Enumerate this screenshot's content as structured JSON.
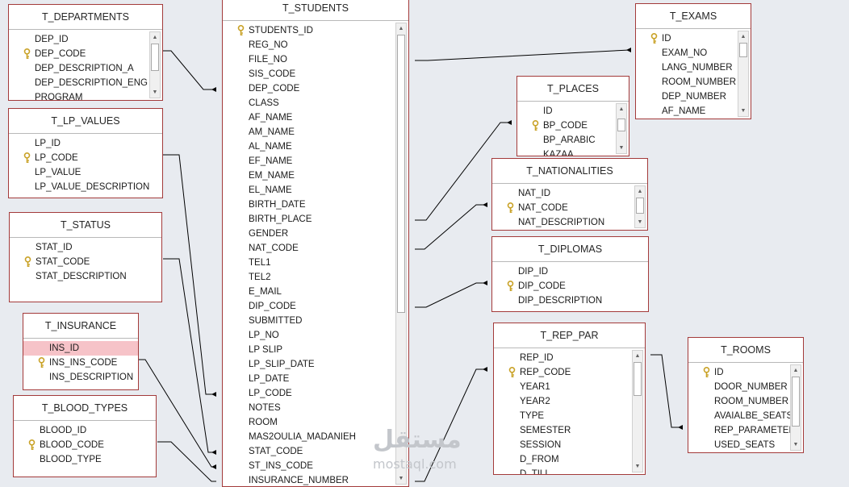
{
  "tables": [
    {
      "id": "t_departments",
      "title": "T_DEPARTMENTS",
      "fields": [
        {
          "name": "DEP_ID"
        },
        {
          "name": "DEP_CODE",
          "key": true
        },
        {
          "name": "DEP_DESCRIPTION_A"
        },
        {
          "name": "DEP_DESCRIPTION_ENG"
        },
        {
          "name": "PROGRAM"
        }
      ]
    },
    {
      "id": "t_lp_values",
      "title": "T_LP_VALUES",
      "fields": [
        {
          "name": "LP_ID"
        },
        {
          "name": "LP_CODE",
          "key": true
        },
        {
          "name": "LP_VALUE"
        },
        {
          "name": "LP_VALUE_DESCRIPTION"
        }
      ]
    },
    {
      "id": "t_status",
      "title": "T_STATUS",
      "fields": [
        {
          "name": "STAT_ID"
        },
        {
          "name": "STAT_CODE",
          "key": true
        },
        {
          "name": "STAT_DESCRIPTION"
        }
      ]
    },
    {
      "id": "t_insurance",
      "title": "T_INSURANCE",
      "fields": [
        {
          "name": "INS_ID",
          "selected": true
        },
        {
          "name": "INS_INS_CODE",
          "key": true
        },
        {
          "name": "INS_DESCRIPTION"
        }
      ]
    },
    {
      "id": "t_blood_types",
      "title": "T_BLOOD_TYPES",
      "fields": [
        {
          "name": "BLOOD_ID"
        },
        {
          "name": "BLOOD_CODE",
          "key": true
        },
        {
          "name": "BLOOD_TYPE"
        }
      ]
    },
    {
      "id": "t_students",
      "title": "T_STUDENTS",
      "fields": [
        {
          "name": "STUDENTS_ID",
          "key": true
        },
        {
          "name": "REG_NO"
        },
        {
          "name": "FILE_NO"
        },
        {
          "name": "SIS_CODE"
        },
        {
          "name": "DEP_CODE"
        },
        {
          "name": "CLASS"
        },
        {
          "name": "AF_NAME"
        },
        {
          "name": "AM_NAME"
        },
        {
          "name": "AL_NAME"
        },
        {
          "name": "EF_NAME"
        },
        {
          "name": "EM_NAME"
        },
        {
          "name": "EL_NAME"
        },
        {
          "name": "BIRTH_DATE"
        },
        {
          "name": "BIRTH_PLACE"
        },
        {
          "name": "GENDER"
        },
        {
          "name": "NAT_CODE"
        },
        {
          "name": "TEL1"
        },
        {
          "name": "TEL2"
        },
        {
          "name": "E_MAIL"
        },
        {
          "name": "DIP_CODE"
        },
        {
          "name": "SUBMITTED"
        },
        {
          "name": "LP_NO"
        },
        {
          "name": "LP SLIP"
        },
        {
          "name": "LP_SLIP_DATE"
        },
        {
          "name": "LP_DATE"
        },
        {
          "name": "LP_CODE"
        },
        {
          "name": "NOTES"
        },
        {
          "name": "ROOM"
        },
        {
          "name": "MAS2OULIA_MADANIEH"
        },
        {
          "name": "STAT_CODE"
        },
        {
          "name": "ST_INS_CODE"
        },
        {
          "name": "INSURANCE_NUMBER"
        }
      ]
    },
    {
      "id": "t_places",
      "title": "T_PLACES",
      "fields": [
        {
          "name": "ID"
        },
        {
          "name": "BP_CODE",
          "key": true
        },
        {
          "name": "BP_ARABIC"
        },
        {
          "name": "KAZAA"
        }
      ]
    },
    {
      "id": "t_nationalities",
      "title": "T_NATIONALITIES",
      "fields": [
        {
          "name": "NAT_ID"
        },
        {
          "name": "NAT_CODE",
          "key": true
        },
        {
          "name": "NAT_DESCRIPTION"
        }
      ]
    },
    {
      "id": "t_diplomas",
      "title": "T_DIPLOMAS",
      "fields": [
        {
          "name": "DIP_ID"
        },
        {
          "name": "DIP_CODE",
          "key": true
        },
        {
          "name": "DIP_DESCRIPTION"
        }
      ]
    },
    {
      "id": "t_rep_par",
      "title": "T_REP_PAR",
      "fields": [
        {
          "name": "REP_ID"
        },
        {
          "name": "REP_CODE",
          "key": true
        },
        {
          "name": "YEAR1"
        },
        {
          "name": "YEAR2"
        },
        {
          "name": "TYPE"
        },
        {
          "name": "SEMESTER"
        },
        {
          "name": "SESSION"
        },
        {
          "name": "D_FROM"
        },
        {
          "name": "D_TILL"
        }
      ]
    },
    {
      "id": "t_exams",
      "title": "T_EXAMS",
      "fields": [
        {
          "name": "ID",
          "key": true
        },
        {
          "name": "EXAM_NO"
        },
        {
          "name": "LANG_NUMBER"
        },
        {
          "name": "ROOM_NUMBER"
        },
        {
          "name": "DEP_NUMBER"
        },
        {
          "name": "AF_NAME"
        }
      ]
    },
    {
      "id": "t_rooms",
      "title": "T_ROOMS",
      "fields": [
        {
          "name": "ID",
          "key": true
        },
        {
          "name": "DOOR_NUMBER"
        },
        {
          "name": "ROOM_NUMBER"
        },
        {
          "name": "AVAIALBE_SEATS"
        },
        {
          "name": "REP_PARAMETER"
        },
        {
          "name": "USED_SEATS"
        }
      ]
    }
  ],
  "watermark": {
    "arabic": "مستقل",
    "latin": "mostaql.com"
  },
  "colors": {
    "table_border": "#a33a3a",
    "selected_row": "#f6c3c8",
    "background": "#e8ebf0",
    "key_icon": "#c9a227"
  }
}
